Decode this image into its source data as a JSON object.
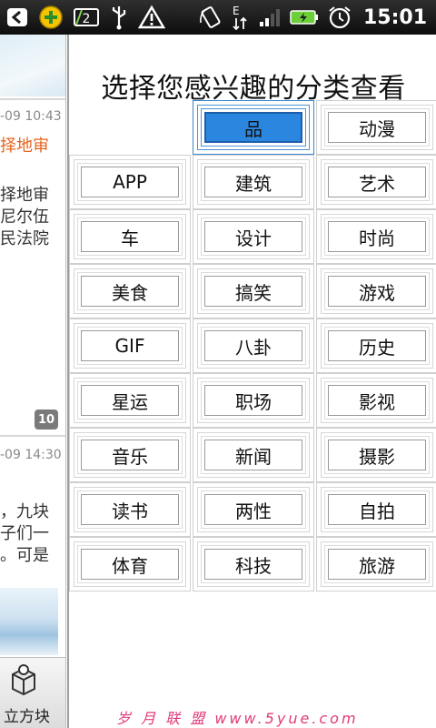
{
  "status_bar": {
    "time": "15:01",
    "icons": [
      "back-arrow-icon",
      "plus-badge-icon",
      "battery-2-icon",
      "usb-icon",
      "warning-icon",
      "rotate-icon",
      "data-transfer-icon",
      "signal-icon",
      "battery-charging-icon",
      "alarm-icon"
    ],
    "accent": "#f5c400"
  },
  "background_list": {
    "items": [
      {
        "time": "-09 10:43",
        "title": "择地审",
        "lines": [
          "择地审",
          "尼尔伍",
          "民法院"
        ],
        "badge": "10"
      },
      {
        "time": "-09 14:30",
        "lines": [
          "，九块",
          "子们一",
          "。可是"
        ]
      }
    ],
    "bottom_label": "立方块"
  },
  "panel": {
    "title": "选择您感兴趣的分类查看",
    "categories": [
      "",
      "品",
      "动漫",
      "APP",
      "建筑",
      "艺术",
      "车",
      "设计",
      "时尚",
      "美食",
      "搞笑",
      "游戏",
      "GIF",
      "八卦",
      "历史",
      "星运",
      "职场",
      "影视",
      "音乐",
      "新闻",
      "摄影",
      "读书",
      "两性",
      "自拍",
      "体育",
      "科技",
      "旅游"
    ],
    "selected": "品",
    "selected_color": "#2b86e0"
  },
  "watermark": "岁 月 联 盟  www.5yue.com"
}
